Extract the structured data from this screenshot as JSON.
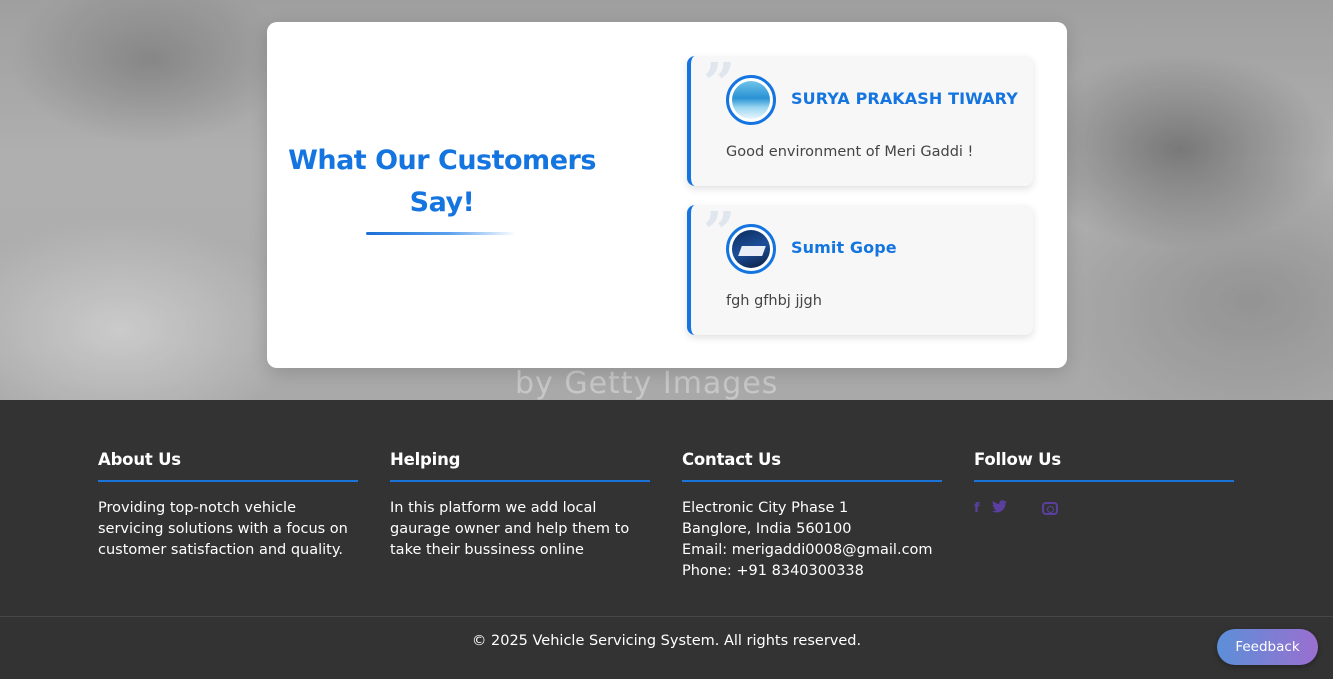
{
  "hero": {
    "watermark": "by Getty Images"
  },
  "testimonials": {
    "title": "What Our Customers Say!",
    "reviews": [
      {
        "name": "SURYA PRAKASH TIWARY",
        "text": "Good environment of Meri Gaddi !",
        "quote_glyph": "”"
      },
      {
        "name": "Sumit Gope",
        "text": "fgh gfhbj jjgh",
        "quote_glyph": "”"
      }
    ]
  },
  "footer": {
    "about": {
      "heading": "About Us",
      "lines": [
        "Providing top-notch vehicle",
        "servicing solutions with a focus on",
        "customer satisfaction and quality."
      ]
    },
    "helping": {
      "heading": "Helping",
      "lines": [
        "In this platform we add local",
        "gaurage owner and help them to",
        "take their bussiness online"
      ]
    },
    "contact": {
      "heading": "Contact Us",
      "lines": [
        "Electronic City Phase 1",
        "Banglore, India 560100",
        "Email: merigaddi0008@gmail.com",
        "Phone: +91 8340300338"
      ]
    },
    "follow": {
      "heading": "Follow Us",
      "icons": [
        "facebook-icon",
        "twitter-icon",
        "instagram-icon"
      ],
      "icon_color": "#5a3fa0"
    },
    "copyright": "© 2025 Vehicle Servicing System. All rights reserved."
  },
  "feedback": {
    "label": "Feedback"
  },
  "colors": {
    "accent": "#1575e0",
    "footer_bg": "#333333"
  }
}
